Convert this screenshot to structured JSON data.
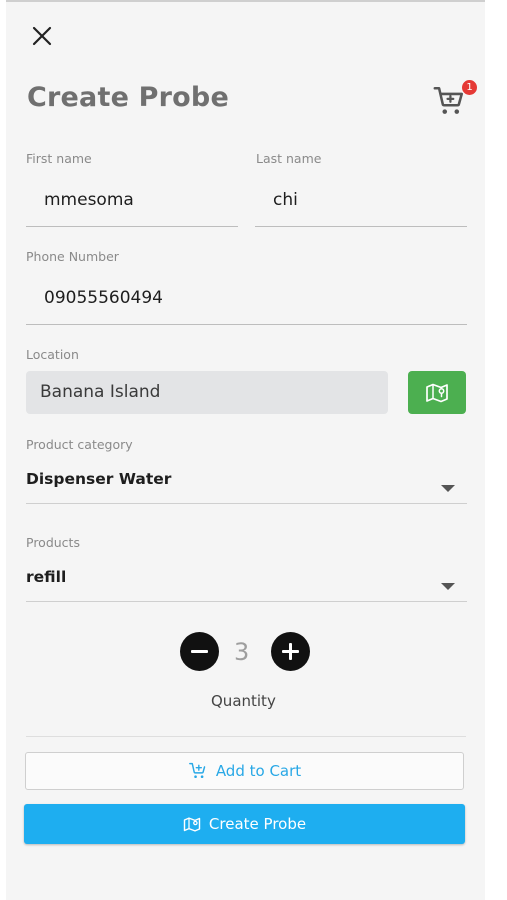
{
  "header": {
    "title": "Create Probe",
    "cart_count": "1"
  },
  "form": {
    "first_name": {
      "label": "First name",
      "value": "mmesoma"
    },
    "last_name": {
      "label": "Last name",
      "value": "chi"
    },
    "phone": {
      "label": "Phone Number",
      "value": "09055560494"
    },
    "location": {
      "label": "Location",
      "value": "Banana Island"
    },
    "category": {
      "label": "Product category",
      "value": "Dispenser Water"
    },
    "products": {
      "label": "Products",
      "value": "refill"
    },
    "quantity": {
      "value": "3",
      "label": "Quantity"
    }
  },
  "actions": {
    "add_to_cart": "Add to Cart",
    "create_probe": "Create Probe"
  },
  "colors": {
    "map_button": "#4caf50",
    "primary": "#1eaef0",
    "badge": "#e53935",
    "accent_text": "#29a8e6"
  },
  "icons": [
    "close-icon",
    "cart-icon",
    "map-icon",
    "minus-icon",
    "plus-icon",
    "add-cart-icon"
  ]
}
